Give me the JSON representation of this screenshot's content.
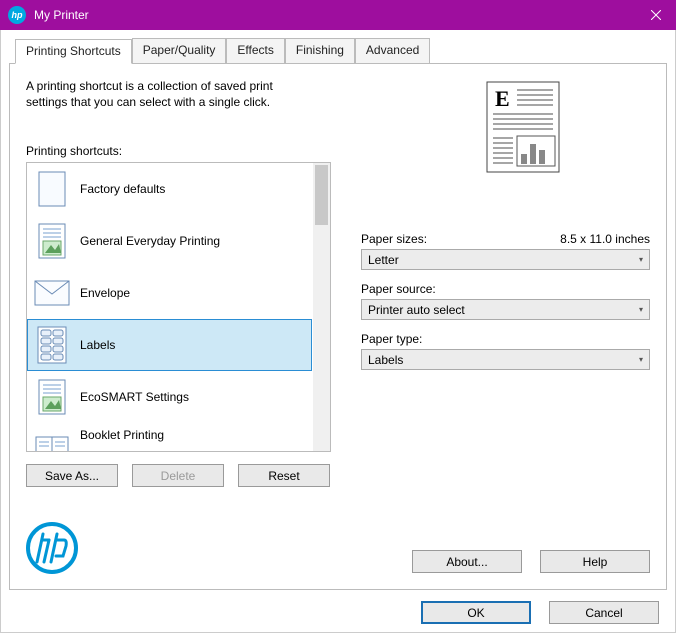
{
  "window": {
    "title": "My Printer"
  },
  "tabs": [
    "Printing Shortcuts",
    "Paper/Quality",
    "Effects",
    "Finishing",
    "Advanced"
  ],
  "intro": "A printing shortcut is a collection of saved print settings that you can select with a single click.",
  "shortcuts_label": "Printing shortcuts:",
  "shortcuts": [
    {
      "label": "Factory defaults",
      "icon": "blank-page"
    },
    {
      "label": "General Everyday Printing",
      "icon": "photo-doc"
    },
    {
      "label": "Envelope",
      "icon": "envelope"
    },
    {
      "label": "Labels",
      "icon": "labels"
    },
    {
      "label": "EcoSMART Settings",
      "icon": "photo-doc"
    },
    {
      "label": "Booklet Printing",
      "icon": "booklet"
    }
  ],
  "selected_index": 3,
  "buttons": {
    "save_as": "Save As...",
    "delete": "Delete",
    "reset": "Reset",
    "about": "About...",
    "help": "Help",
    "ok": "OK",
    "cancel": "Cancel"
  },
  "fields": {
    "paper_sizes_label": "Paper sizes:",
    "paper_sizes_dim": "8.5 x 11.0 inches",
    "paper_sizes_value": "Letter",
    "paper_source_label": "Paper source:",
    "paper_source_value": "Printer auto select",
    "paper_type_label": "Paper type:",
    "paper_type_value": "Labels"
  }
}
